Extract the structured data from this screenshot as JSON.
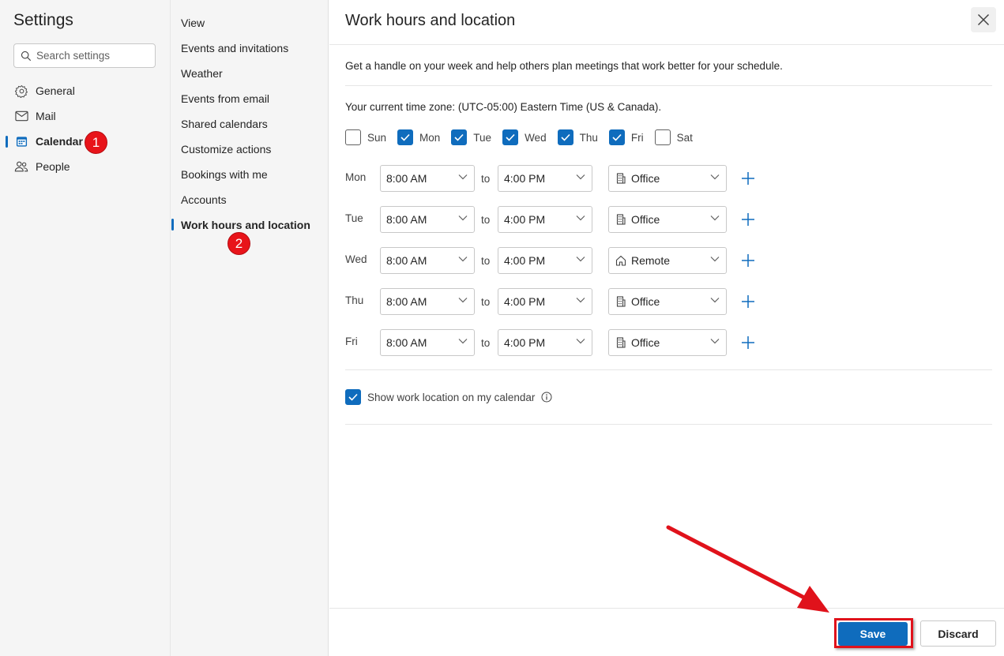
{
  "settings_nav": {
    "title": "Settings",
    "search_placeholder": "Search settings",
    "items": [
      {
        "label": "General",
        "icon": "gear-icon",
        "active": false
      },
      {
        "label": "Mail",
        "icon": "mail-icon",
        "active": false
      },
      {
        "label": "Calendar",
        "icon": "calendar-icon",
        "active": true
      },
      {
        "label": "People",
        "icon": "people-icon",
        "active": false
      }
    ]
  },
  "calendar_nav": {
    "items": [
      {
        "label": "View",
        "active": false
      },
      {
        "label": "Events and invitations",
        "active": false
      },
      {
        "label": "Weather",
        "active": false
      },
      {
        "label": "Events from email",
        "active": false
      },
      {
        "label": "Shared calendars",
        "active": false
      },
      {
        "label": "Customize actions",
        "active": false
      },
      {
        "label": "Bookings with me",
        "active": false
      },
      {
        "label": "Accounts",
        "active": false
      },
      {
        "label": "Work hours and location",
        "active": true
      }
    ]
  },
  "annotations": {
    "step1": "1",
    "step2": "2",
    "highlight_color": "#e0121b"
  },
  "panel": {
    "title": "Work hours and location",
    "description": "Get a handle on your week and help others plan meetings that work better for your schedule.",
    "timezone_text": "Your current time zone: (UTC-05:00) Eastern Time (US & Canada).",
    "days": [
      {
        "label": "Sun",
        "checked": false
      },
      {
        "label": "Mon",
        "checked": true
      },
      {
        "label": "Tue",
        "checked": true
      },
      {
        "label": "Wed",
        "checked": true
      },
      {
        "label": "Thu",
        "checked": true
      },
      {
        "label": "Fri",
        "checked": true
      },
      {
        "label": "Sat",
        "checked": false
      }
    ],
    "to_label": "to",
    "schedule": [
      {
        "day": "Mon",
        "start": "8:00 AM",
        "end": "4:00 PM",
        "location": "Office",
        "location_icon": "building-icon"
      },
      {
        "day": "Tue",
        "start": "8:00 AM",
        "end": "4:00 PM",
        "location": "Office",
        "location_icon": "building-icon"
      },
      {
        "day": "Wed",
        "start": "8:00 AM",
        "end": "4:00 PM",
        "location": "Remote",
        "location_icon": "home-icon"
      },
      {
        "day": "Thu",
        "start": "8:00 AM",
        "end": "4:00 PM",
        "location": "Office",
        "location_icon": "building-icon"
      },
      {
        "day": "Fri",
        "start": "8:00 AM",
        "end": "4:00 PM",
        "location": "Office",
        "location_icon": "building-icon"
      }
    ],
    "show_location_label": "Show work location on my calendar",
    "show_location_checked": true,
    "save_label": "Save",
    "discard_label": "Discard",
    "accent_color": "#0f6cbd"
  }
}
